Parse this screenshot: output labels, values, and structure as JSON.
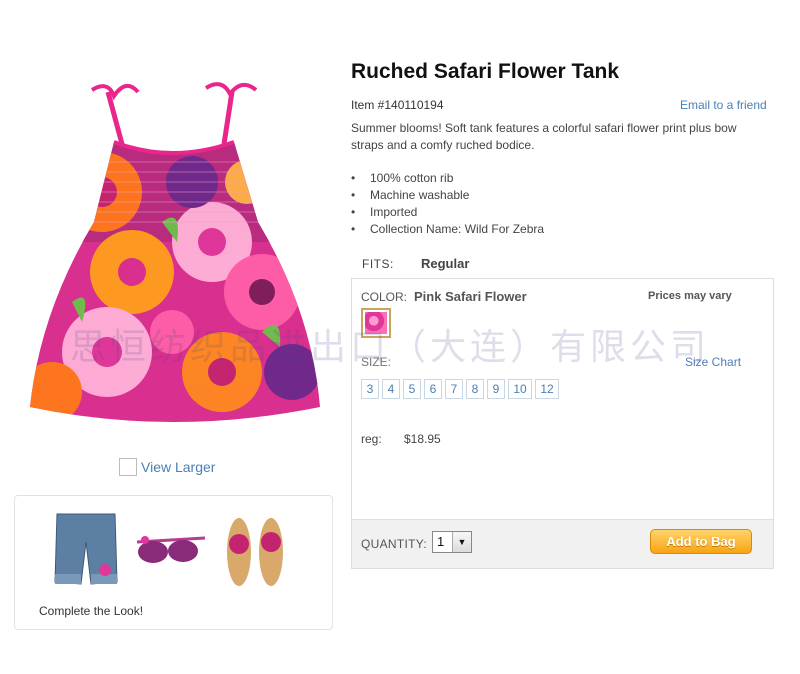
{
  "product": {
    "title": "Ruched Safari Flower Tank",
    "item_number": "Item #140110194",
    "email_link": "Email to a friend",
    "description": "Summer blooms! Soft tank features a colorful safari flower print plus bow straps and a comfy ruched bodice.",
    "features": [
      "100% cotton rib",
      "Machine washable",
      "Imported",
      "Collection Name: Wild For Zebra"
    ],
    "fits_label": "FITS:",
    "fits_value": "Regular"
  },
  "left": {
    "view_larger": "View Larger",
    "complete_look": "Complete the Look!"
  },
  "options": {
    "color_label": "COLOR:",
    "color_value": "Pink Safari Flower",
    "prices_note": "Prices may vary",
    "size_label": "SIZE:",
    "size_chart": "Size Chart",
    "sizes": [
      "3",
      "4",
      "5",
      "6",
      "7",
      "8",
      "9",
      "10",
      "12"
    ],
    "reg_label": "reg:",
    "reg_price": "$18.95",
    "quantity_label": "QUANTITY:",
    "quantity_value": "1",
    "add_to_bag": "Add to Bag"
  },
  "watermark": "思恒纺织品进出口（大连）有限公司",
  "colors": {
    "link": "#4a7fb5",
    "button_orange": "#f8a413",
    "dress_pink": "#e0379a",
    "panel_border": "#dedede"
  }
}
